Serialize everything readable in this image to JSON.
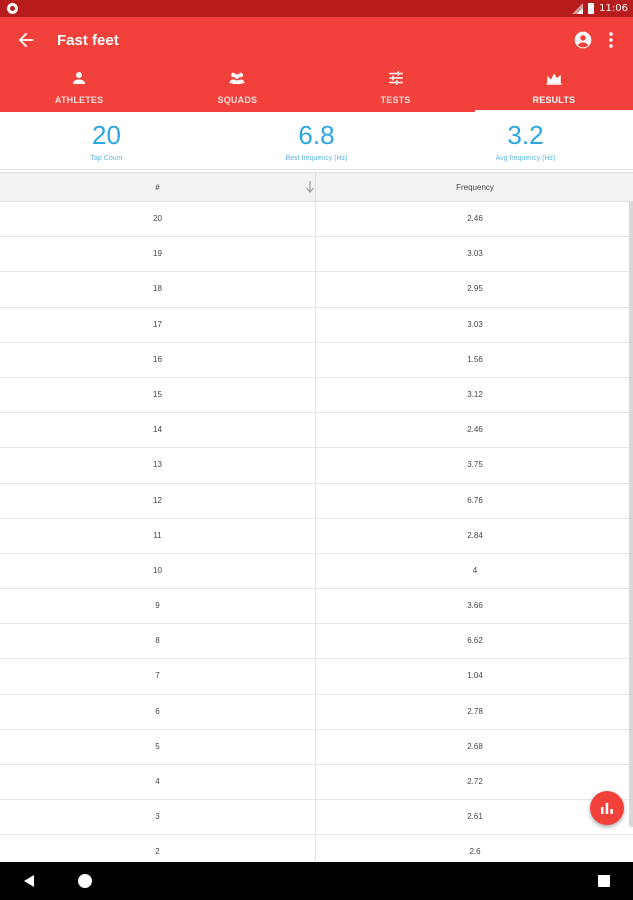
{
  "status_bar": {
    "time": "11:06",
    "icons": [
      "notification-dot-icon",
      "signal-icon",
      "battery-icon"
    ]
  },
  "app_bar": {
    "title": "Fast feet",
    "icons": [
      "arrow-back-icon",
      "account-circle-icon",
      "more-vert-icon"
    ],
    "background": "#f2413b"
  },
  "tabs": [
    {
      "label": "ATHLETES",
      "icon": "person-icon",
      "active": false
    },
    {
      "label": "SQUADS",
      "icon": "group-icon",
      "active": false
    },
    {
      "label": "TESTS",
      "icon": "tune-icon",
      "active": false
    },
    {
      "label": "RESULTS",
      "icon": "area-chart-icon",
      "active": true
    }
  ],
  "summary": [
    {
      "value": "20",
      "label": "Tap Count"
    },
    {
      "value": "6.8",
      "label": "Best frequency (Hz)"
    },
    {
      "value": "3.2",
      "label": "Avg frequency (Hz)"
    }
  ],
  "table": {
    "columns": [
      "#",
      "Frequency"
    ],
    "sort": {
      "column": "#",
      "direction": "descending",
      "icon": "arrow-down-icon"
    },
    "rows": [
      {
        "num": "20",
        "freq": "2.46"
      },
      {
        "num": "19",
        "freq": "3.03"
      },
      {
        "num": "18",
        "freq": "2.95"
      },
      {
        "num": "17",
        "freq": "3.03"
      },
      {
        "num": "16",
        "freq": "1.56"
      },
      {
        "num": "15",
        "freq": "3.12"
      },
      {
        "num": "14",
        "freq": "2.46"
      },
      {
        "num": "13",
        "freq": "3.75"
      },
      {
        "num": "12",
        "freq": "6.76"
      },
      {
        "num": "11",
        "freq": "2.84"
      },
      {
        "num": "10",
        "freq": "4"
      },
      {
        "num": "9",
        "freq": "3.66"
      },
      {
        "num": "8",
        "freq": "6.62"
      },
      {
        "num": "7",
        "freq": "1.04"
      },
      {
        "num": "6",
        "freq": "2.78"
      },
      {
        "num": "5",
        "freq": "2.68"
      },
      {
        "num": "4",
        "freq": "2.72"
      },
      {
        "num": "3",
        "freq": "2.61"
      },
      {
        "num": "2",
        "freq": "2.6"
      }
    ]
  },
  "fab": {
    "icon": "bar-chart-icon"
  },
  "nav_bar": {
    "icons": [
      "nav-back-icon",
      "nav-home-icon",
      "nav-recents-icon"
    ]
  },
  "colors": {
    "accent": "#f2413b",
    "status_bar": "#b71c1c",
    "stat_value": "#2aa7e0"
  }
}
